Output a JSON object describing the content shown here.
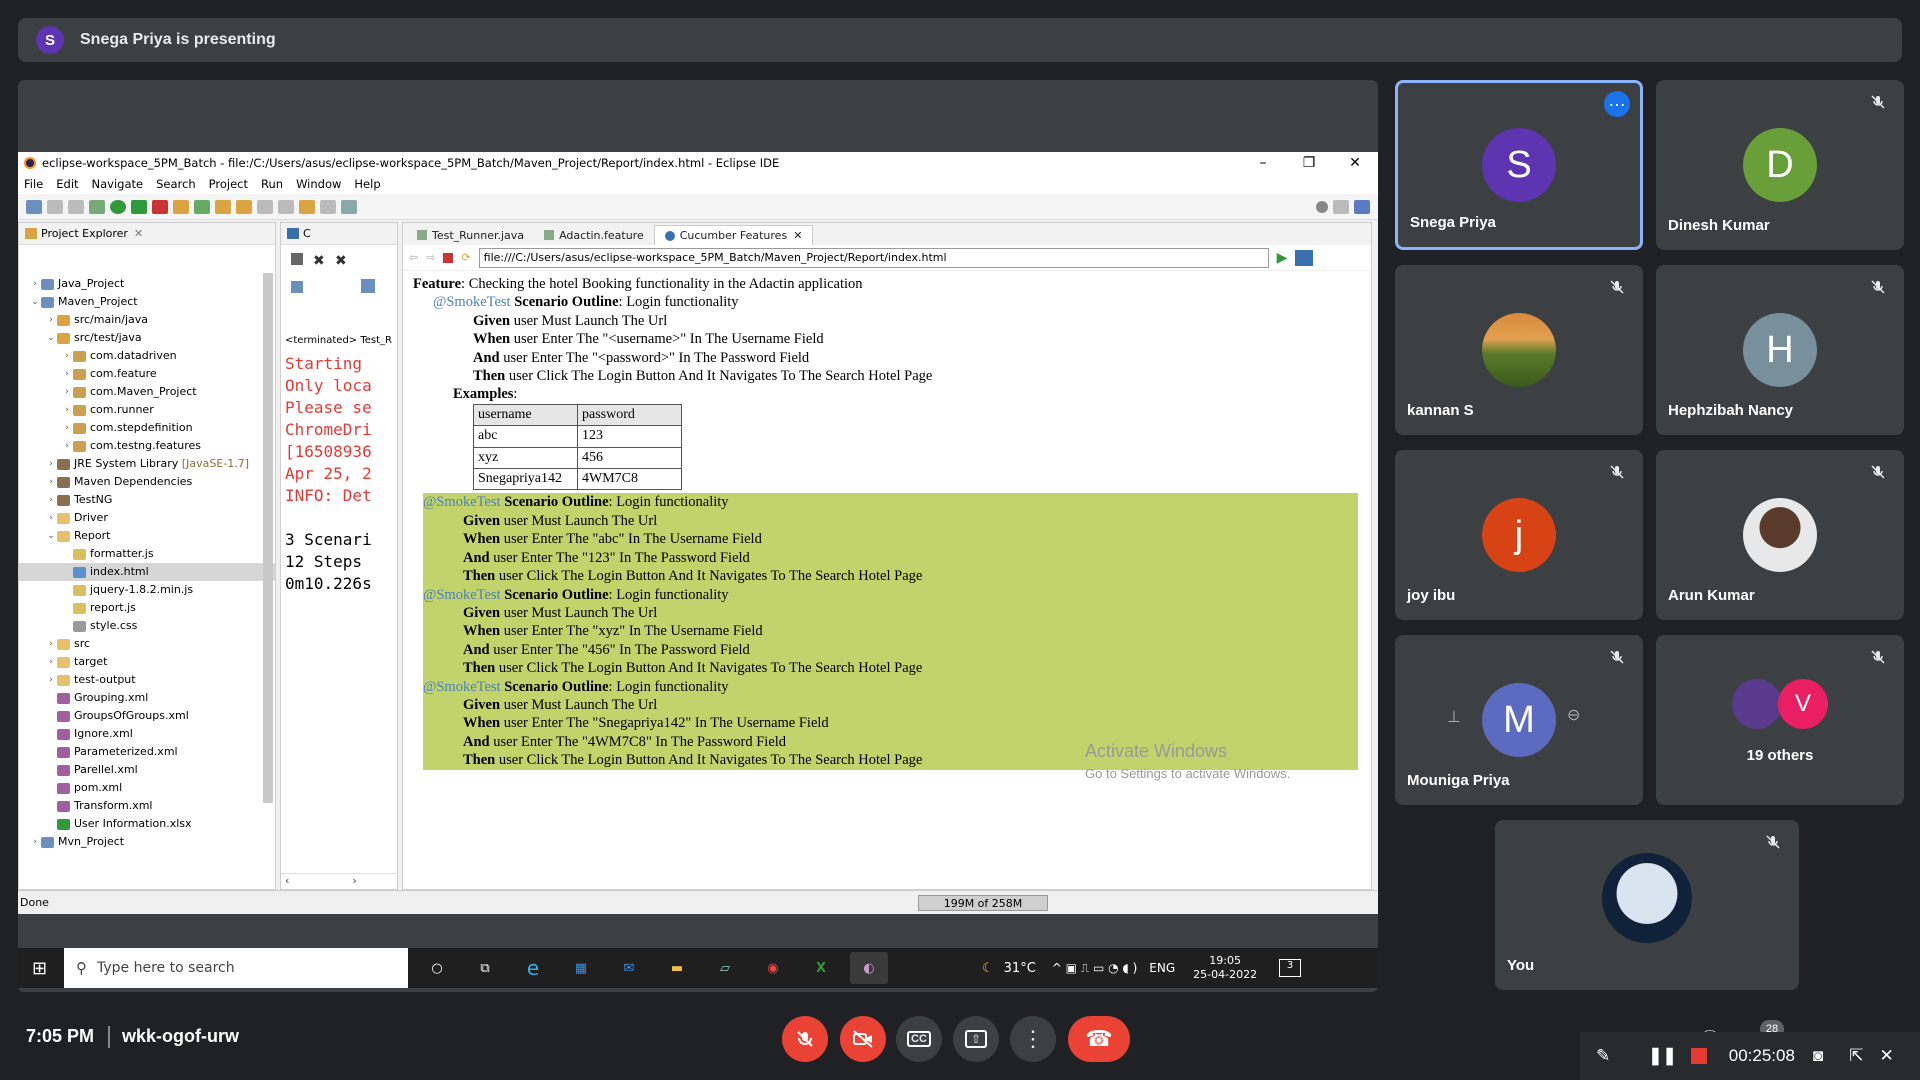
{
  "presenting_banner": {
    "avatar_letter": "S",
    "text": "Snega Priya is presenting"
  },
  "eclipse": {
    "title": "eclipse-workspace_5PM_Batch - file:/C:/Users/asus/eclipse-workspace_5PM_Batch/Maven_Project/Report/index.html - Eclipse IDE",
    "menu": [
      "File",
      "Edit",
      "Navigate",
      "Search",
      "Project",
      "Run",
      "Window",
      "Help"
    ],
    "project_explorer_tab": "Project Explorer",
    "console_tab": "C",
    "tree": [
      {
        "label": "Java_Project",
        "indent": 0,
        "arrow": "›",
        "icon": "project"
      },
      {
        "label": "Maven_Project",
        "indent": 0,
        "arrow": "⌄",
        "icon": "project"
      },
      {
        "label": "src/main/java",
        "indent": 1,
        "arrow": "›",
        "icon": "src"
      },
      {
        "label": "src/test/java",
        "indent": 1,
        "arrow": "⌄",
        "icon": "src"
      },
      {
        "label": "com.datadriven",
        "indent": 2,
        "arrow": "›",
        "icon": "pkg"
      },
      {
        "label": "com.feature",
        "indent": 2,
        "arrow": "›",
        "icon": "pkg"
      },
      {
        "label": "com.Maven_Project",
        "indent": 2,
        "arrow": "›",
        "icon": "pkg"
      },
      {
        "label": "com.runner",
        "indent": 2,
        "arrow": "›",
        "icon": "pkg"
      },
      {
        "label": "com.stepdefinition",
        "indent": 2,
        "arrow": "›",
        "icon": "pkg"
      },
      {
        "label": "com.testng.features",
        "indent": 2,
        "arrow": "›",
        "icon": "pkg"
      },
      {
        "label": "JRE System Library [JavaSE-1.7]",
        "indent": 1,
        "arrow": "›",
        "icon": "lib"
      },
      {
        "label": "Maven Dependencies",
        "indent": 1,
        "arrow": "›",
        "icon": "lib"
      },
      {
        "label": "TestNG",
        "indent": 1,
        "arrow": "›",
        "icon": "lib"
      },
      {
        "label": "Driver",
        "indent": 1,
        "arrow": "›",
        "icon": "folder"
      },
      {
        "label": "Report",
        "indent": 1,
        "arrow": "⌄",
        "icon": "folder"
      },
      {
        "label": "formatter.js",
        "indent": 2,
        "arrow": "",
        "icon": "js"
      },
      {
        "label": "index.html",
        "indent": 2,
        "arrow": "",
        "icon": "html"
      },
      {
        "label": "jquery-1.8.2.min.js",
        "indent": 2,
        "arrow": "",
        "icon": "js"
      },
      {
        "label": "report.js",
        "indent": 2,
        "arrow": "",
        "icon": "js"
      },
      {
        "label": "style.css",
        "indent": 2,
        "arrow": "",
        "icon": "css"
      },
      {
        "label": "src",
        "indent": 1,
        "arrow": "›",
        "icon": "folder"
      },
      {
        "label": "target",
        "indent": 1,
        "arrow": "›",
        "icon": "folder"
      },
      {
        "label": "test-output",
        "indent": 1,
        "arrow": "›",
        "icon": "folder"
      },
      {
        "label": "Grouping.xml",
        "indent": 1,
        "arrow": "",
        "icon": "xml"
      },
      {
        "label": "GroupsOfGroups.xml",
        "indent": 1,
        "arrow": "",
        "icon": "xml"
      },
      {
        "label": "Ignore.xml",
        "indent": 1,
        "arrow": "",
        "icon": "xml"
      },
      {
        "label": "Parameterized.xml",
        "indent": 1,
        "arrow": "",
        "icon": "xml"
      },
      {
        "label": "Parellel.xml",
        "indent": 1,
        "arrow": "",
        "icon": "xml"
      },
      {
        "label": "pom.xml",
        "indent": 1,
        "arrow": "",
        "icon": "xml"
      },
      {
        "label": "Transform.xml",
        "indent": 1,
        "arrow": "",
        "icon": "xml"
      },
      {
        "label": "User Information.xlsx",
        "indent": 1,
        "arrow": "",
        "icon": "xlsx"
      },
      {
        "label": "Mvn_Project",
        "indent": 0,
        "arrow": "›",
        "icon": "project"
      }
    ],
    "console_header": "<terminated> Test_R",
    "console_lines_red": [
      "Starting",
      "Only loca",
      "Please se",
      "ChromeDri",
      "[16508936",
      "Apr 25, 2",
      "INFO: Det"
    ],
    "console_lines_black": [
      "",
      "3 Scenari",
      "12 Steps",
      "0m10.226s"
    ],
    "editor_tabs": [
      "Test_Runner.java",
      "Adactin.feature",
      "Cucumber Features"
    ],
    "url": "file:///C:/Users/asus/eclipse-workspace_5PM_Batch/Maven_Project/Report/index.html",
    "report": {
      "feature_kw": "Feature",
      "feature_text": ": Checking the hotel Booking functionality in the Adactin application",
      "tag": "@SmokeTest",
      "outline_kw": "Scenario Outline",
      "outline_text": ": Login functionality",
      "outline_steps": [
        {
          "kw": "Given",
          "text": " user Must Launch The Url"
        },
        {
          "kw": "When",
          "text": " user Enter The \"<username>\" In The Username Field"
        },
        {
          "kw": "And",
          "text": " user Enter The \"<password>\" In The Password Field"
        },
        {
          "kw": "Then",
          "text": " user Click The Login Button And It Navigates To The Search Hotel Page"
        }
      ],
      "examples_kw": "Examples",
      "examples": [
        [
          "username",
          "password"
        ],
        [
          "abc",
          "123"
        ],
        [
          "xyz",
          "456"
        ],
        [
          "Snegapriya142",
          "4WM7C8"
        ]
      ],
      "scenarios": [
        {
          "steps": [
            {
              "kw": "Given",
              "text": " user Must Launch The Url"
            },
            {
              "kw": "When",
              "text": " user Enter The \"abc\" In The Username Field"
            },
            {
              "kw": "And",
              "text": " user Enter The \"123\" In The Password Field"
            },
            {
              "kw": "Then",
              "text": " user Click The Login Button And It Navigates To The Search Hotel Page"
            }
          ]
        },
        {
          "steps": [
            {
              "kw": "Given",
              "text": " user Must Launch The Url"
            },
            {
              "kw": "When",
              "text": " user Enter The \"xyz\" In The Username Field"
            },
            {
              "kw": "And",
              "text": " user Enter The \"456\" In The Password Field"
            },
            {
              "kw": "Then",
              "text": " user Click The Login Button And It Navigates To The Search Hotel Page"
            }
          ]
        },
        {
          "steps": [
            {
              "kw": "Given",
              "text": " user Must Launch The Url"
            },
            {
              "kw": "When",
              "text": " user Enter The \"Snegapriya142\" In The Username Field"
            },
            {
              "kw": "And",
              "text": " user Enter The \"4WM7C8\" In The Password Field"
            },
            {
              "kw": "Then",
              "text": " user Click The Login Button And It Navigates To The Search Hotel Page"
            }
          ]
        }
      ],
      "pass_color": "#c2d36c"
    },
    "watermark_1": "Activate Windows",
    "watermark_2": "Go to Settings to activate Windows.",
    "status": "Done",
    "memory": "199M of 258M"
  },
  "taskbar": {
    "search_placeholder": "Type here to search",
    "temp": "31°C",
    "lang": "ENG",
    "time": "19:05",
    "date": "25-04-2022",
    "notif": "3"
  },
  "participants": [
    {
      "name": "Snega Priya",
      "letter": "S",
      "color": "#5e35b1",
      "kind": "letter"
    },
    {
      "name": "Dinesh Kumar",
      "letter": "D",
      "color": "#689f38",
      "kind": "letter"
    },
    {
      "name": "kannan S",
      "letter": "",
      "color": "#8d8a3e",
      "kind": "photo"
    },
    {
      "name": "Hephzibah Nancy",
      "letter": "H",
      "color": "#78909c",
      "kind": "letter"
    },
    {
      "name": "joy ibu",
      "letter": "j",
      "color": "#d84315",
      "kind": "letter"
    },
    {
      "name": "Arun Kumar",
      "letter": "",
      "color": "#cfcfcf",
      "kind": "photo"
    },
    {
      "name": "Mouniga Priya",
      "letter": "M",
      "color": "#5c6bc0",
      "kind": "letter"
    },
    {
      "name": "19 others",
      "letter": "V",
      "color": "#e91e63",
      "kind": "others"
    },
    {
      "name": "You",
      "letter": "",
      "color": "#1d2b44",
      "kind": "photo"
    }
  ],
  "bottom": {
    "time": "7:05 PM",
    "meeting_code": "wkk-ogof-urw",
    "people_count": "28",
    "rec_time": "00:25:08"
  }
}
